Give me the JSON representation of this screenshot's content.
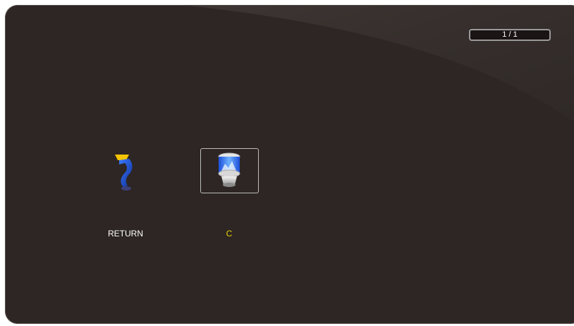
{
  "pagination": {
    "text": "1 / 1"
  },
  "items": [
    {
      "label": "RETURN",
      "icon": "return-arrow-icon",
      "selected": false,
      "label_color": "#ffffff"
    },
    {
      "label": "C",
      "icon": "drive-icon",
      "selected": true,
      "label_color": "#e8d400"
    }
  ],
  "colors": {
    "background": "#2d2624",
    "selected_border": "#bdbdbd",
    "selected_label": "#e8d400"
  }
}
